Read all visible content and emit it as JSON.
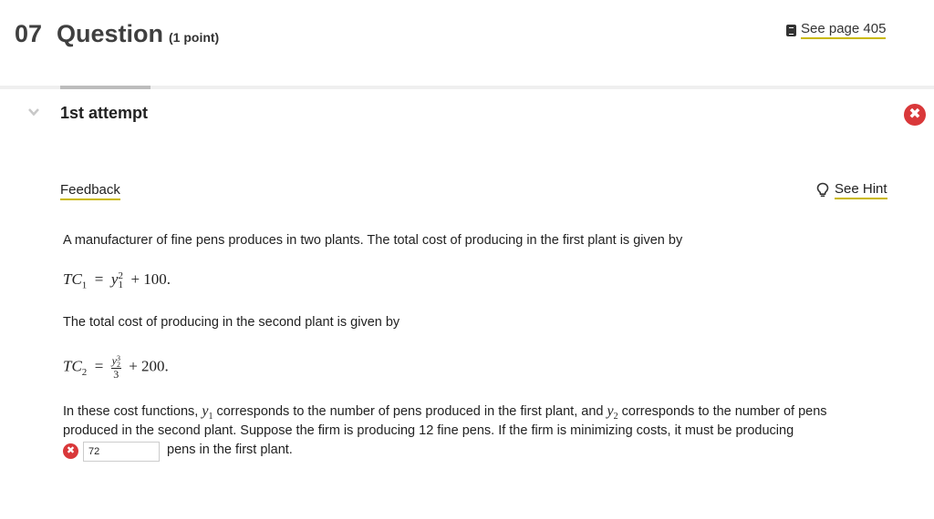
{
  "header": {
    "number": "07",
    "title": "Question",
    "points": "(1 point)",
    "see_page": "See page 405"
  },
  "attempt": {
    "label": "1st attempt",
    "status": "incorrect"
  },
  "links": {
    "feedback": "Feedback",
    "hint": "See Hint"
  },
  "problem": {
    "intro": "A manufacturer of fine pens produces in two plants. The total cost of producing in the first plant is given by",
    "eq1": {
      "lhs": "TC",
      "lhs_sub": "1",
      "var": "y",
      "var_sub": "1",
      "var_sup": "2",
      "const": "+ 100."
    },
    "mid": "The total cost of producing in the second plant is given by",
    "eq2": {
      "lhs": "TC",
      "lhs_sub": "2",
      "num_var": "y",
      "num_sub": "2",
      "num_sup": "3",
      "den": "3",
      "const": "+ 200."
    },
    "body_a": "In these cost functions, ",
    "y1": "y",
    "y1_sub": "1",
    "body_b": " corresponds to the number of pens produced in the first plant, and ",
    "y2": "y",
    "y2_sub": "2",
    "body_c": " corresponds to the number of pens",
    "line2": "produced in the second plant. Suppose the firm is producing 12 fine pens. If the firm is minimizing costs, it must be producing",
    "answer_value": "72",
    "tail": "pens in the first plant."
  },
  "colors": {
    "error": "#d9383a",
    "link_underline": "#c9b800"
  }
}
